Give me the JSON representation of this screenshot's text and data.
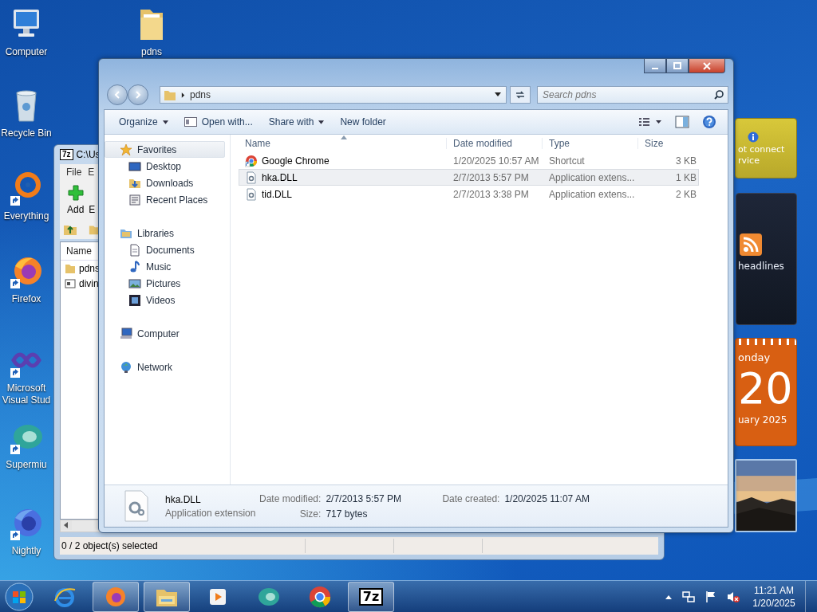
{
  "desktop_icons": [
    {
      "kind": "computer",
      "label": "Computer",
      "shortcut": false
    },
    {
      "kind": "folder",
      "label": "pdns",
      "shortcut": false
    },
    {
      "kind": "recycle",
      "label": "Recycle Bin",
      "shortcut": false
    },
    {
      "kind": "everything",
      "label": "Everything",
      "shortcut": true
    },
    {
      "kind": "firefox",
      "label": "Firefox",
      "shortcut": true
    },
    {
      "kind": "vs",
      "label": "Microsoft Visual Stud",
      "shortcut": true
    },
    {
      "kind": "supermium",
      "label": "Supermiu",
      "shortcut": true
    },
    {
      "kind": "nightly",
      "label": "Nightly",
      "shortcut": true
    }
  ],
  "gadgets": [
    {
      "kind": "weather",
      "lines": [
        "ot connect",
        "rvice"
      ]
    },
    {
      "kind": "feed",
      "text": "headlines"
    },
    {
      "kind": "calendar",
      "weekday": "onday",
      "day": "20",
      "month": "uary 2025"
    },
    {
      "kind": "slideshow"
    }
  ],
  "archive_window": {
    "app_badge": "7z",
    "title": "C:\\Us",
    "menu": [
      "File",
      "E"
    ],
    "toolbar": [
      "Add",
      "E"
    ],
    "columns": [
      "Name"
    ],
    "rows": [
      {
        "kind": "folder",
        "name": "pdns"
      },
      {
        "kind": "file",
        "name": "divin"
      }
    ],
    "status": "0 / 2 object(s) selected"
  },
  "explorer": {
    "address": "pdns",
    "search": {
      "placeholder": "Search pdns"
    },
    "commands": [
      {
        "label": "Organize",
        "menu": true,
        "icon": false
      },
      {
        "label": "Open with...",
        "menu": false,
        "icon": true
      },
      {
        "label": "Share with",
        "menu": true,
        "icon": false
      },
      {
        "label": "New folder",
        "menu": false,
        "icon": false
      }
    ],
    "nav": [
      {
        "kind": "favorites",
        "label": "Favorites",
        "selected": true,
        "children": [
          {
            "kind": "desktop",
            "label": "Desktop",
            "selected": false
          },
          {
            "kind": "downloads",
            "label": "Downloads",
            "selected": false
          },
          {
            "kind": "recent",
            "label": "Recent Places",
            "selected": false
          }
        ]
      },
      {
        "kind": "libraries",
        "label": "Libraries",
        "selected": false,
        "children": [
          {
            "kind": "documents",
            "label": "Documents",
            "selected": false
          },
          {
            "kind": "music",
            "label": "Music",
            "selected": false
          },
          {
            "kind": "pictures",
            "label": "Pictures",
            "selected": false
          },
          {
            "kind": "videos",
            "label": "Videos",
            "selected": false
          }
        ]
      },
      {
        "kind": "computer",
        "label": "Computer",
        "selected": false
      },
      {
        "kind": "network",
        "label": "Network",
        "selected": false
      }
    ],
    "columns": [
      "Name",
      "Date modified",
      "Type",
      "Size"
    ],
    "files": [
      {
        "kind": "chrome",
        "name": "Google Chrome",
        "modified": "1/20/2025 10:57 AM",
        "type": "Shortcut",
        "size": "3 KB",
        "selected": false
      },
      {
        "kind": "dll",
        "name": "hka.DLL",
        "modified": "2/7/2013 5:57 PM",
        "type": "Application extens...",
        "size": "1 KB",
        "selected": true
      },
      {
        "kind": "dll",
        "name": "tid.DLL",
        "modified": "2/7/2013 3:38 PM",
        "type": "Application extens...",
        "size": "2 KB",
        "selected": false
      }
    ],
    "details": {
      "name": "hka.DLL",
      "type": "Application extension",
      "fields": [
        {
          "label": "Date modified:",
          "value": "2/7/2013 5:57 PM"
        },
        {
          "label": "Date created:",
          "value": "1/20/2025 11:07 AM"
        },
        {
          "label": "Size:",
          "value": "717 bytes"
        }
      ]
    }
  },
  "taskbar": {
    "items": [
      {
        "kind": "ie",
        "active": false
      },
      {
        "kind": "firefox",
        "active": true
      },
      {
        "kind": "explorer",
        "active": true
      },
      {
        "kind": "media",
        "active": false
      },
      {
        "kind": "supermium",
        "active": false
      },
      {
        "kind": "chrome",
        "active": false
      },
      {
        "kind": "sevenzip",
        "label": "7z",
        "active": true
      }
    ],
    "time": "11:21 AM",
    "date": "1/20/2025"
  }
}
